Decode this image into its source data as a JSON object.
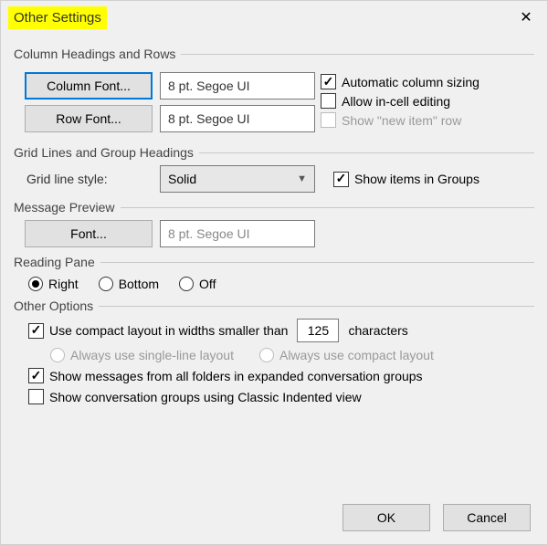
{
  "title": "Other Settings",
  "group1": {
    "title": "Column Headings and Rows",
    "colFontBtn": "Column Font...",
    "colFontVal": "8 pt. Segoe UI",
    "rowFontBtn": "Row Font...",
    "rowFontVal": "8 pt. Segoe UI",
    "autoSize": "Automatic column sizing",
    "inCell": "Allow in-cell editing",
    "newItem": "Show \"new item\" row"
  },
  "group2": {
    "title": "Grid Lines and Group Headings",
    "gridLabel": "Grid line style:",
    "gridValue": "Solid",
    "showGroups": "Show items in Groups"
  },
  "group3": {
    "title": "Message Preview",
    "fontBtn": "Font...",
    "fontVal": "8 pt. Segoe UI"
  },
  "group4": {
    "title": "Reading Pane",
    "right": "Right",
    "bottom": "Bottom",
    "off": "Off"
  },
  "group5": {
    "title": "Other Options",
    "compactPre": "Use compact layout in widths smaller than",
    "compactVal": "125",
    "compactPost": "characters",
    "singleLine": "Always use single-line layout",
    "alwaysCompact": "Always use compact layout",
    "expanded": "Show messages from all folders in expanded conversation groups",
    "classic": "Show conversation groups using Classic Indented view"
  },
  "buttons": {
    "ok": "OK",
    "cancel": "Cancel"
  }
}
